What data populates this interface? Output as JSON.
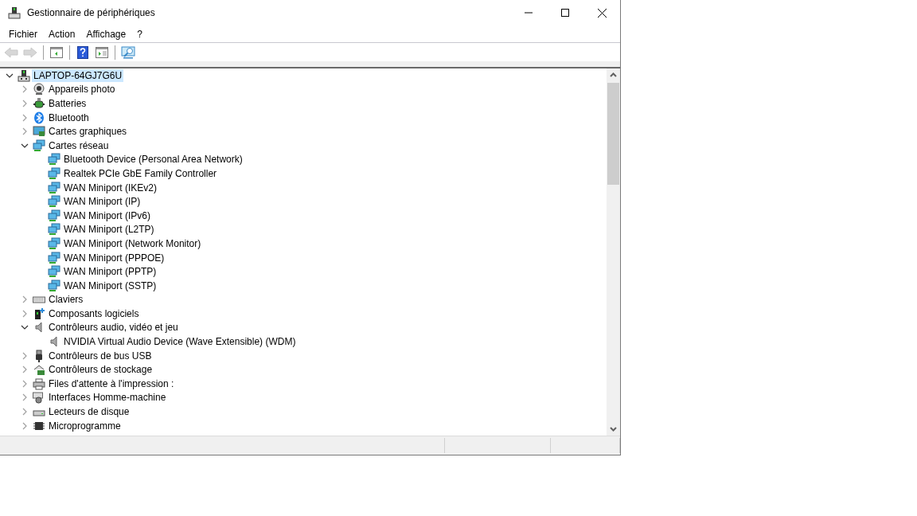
{
  "window": {
    "title": "Gestionnaire de périphériques"
  },
  "menu": [
    "Fichier",
    "Action",
    "Affichage",
    "?"
  ],
  "toolbar": [
    {
      "kind": "back",
      "disabled": true
    },
    {
      "kind": "forward",
      "disabled": true
    },
    {
      "kind": "separator"
    },
    {
      "kind": "pane",
      "disabled": false
    },
    {
      "kind": "separator"
    },
    {
      "kind": "help",
      "disabled": false
    },
    {
      "kind": "view",
      "disabled": false
    },
    {
      "kind": "separator"
    },
    {
      "kind": "scan",
      "disabled": false
    }
  ],
  "tree": {
    "label": "LAPTOP-64GJ7G6U",
    "kind": "computer",
    "expanded": true,
    "selected": true,
    "children": [
      {
        "label": "Appareils photo",
        "kind": "camera",
        "expanded": false,
        "selected": false
      },
      {
        "label": "Batteries",
        "kind": "battery",
        "expanded": false,
        "selected": false
      },
      {
        "label": "Bluetooth",
        "kind": "bluetooth",
        "expanded": false,
        "selected": false
      },
      {
        "label": "Cartes graphiques",
        "kind": "display",
        "expanded": false,
        "selected": false
      },
      {
        "label": "Cartes réseau",
        "kind": "network",
        "expanded": true,
        "selected": false,
        "children": [
          {
            "label": "Bluetooth Device (Personal Area Network)",
            "kind": "network",
            "selected": false
          },
          {
            "label": "Realtek PCIe GbE Family Controller",
            "kind": "network",
            "selected": false
          },
          {
            "label": "WAN Miniport (IKEv2)",
            "kind": "network",
            "selected": false
          },
          {
            "label": "WAN Miniport (IP)",
            "kind": "network",
            "selected": false
          },
          {
            "label": "WAN Miniport (IPv6)",
            "kind": "network",
            "selected": false
          },
          {
            "label": "WAN Miniport (L2TP)",
            "kind": "network",
            "selected": false
          },
          {
            "label": "WAN Miniport (Network Monitor)",
            "kind": "network",
            "selected": false
          },
          {
            "label": "WAN Miniport (PPPOE)",
            "kind": "network",
            "selected": false
          },
          {
            "label": "WAN Miniport (PPTP)",
            "kind": "network",
            "selected": false
          },
          {
            "label": "WAN Miniport (SSTP)",
            "kind": "network",
            "selected": false
          }
        ]
      },
      {
        "label": "Claviers",
        "kind": "keyboard",
        "expanded": false,
        "selected": false
      },
      {
        "label": "Composants logiciels",
        "kind": "software",
        "expanded": false,
        "selected": false
      },
      {
        "label": "Contrôleurs audio, vidéo et jeu",
        "kind": "audio",
        "expanded": true,
        "selected": false,
        "children": [
          {
            "label": "NVIDIA Virtual Audio Device (Wave Extensible) (WDM)",
            "kind": "audio",
            "selected": false
          }
        ]
      },
      {
        "label": "Contrôleurs de bus USB",
        "kind": "usb",
        "expanded": false,
        "selected": false
      },
      {
        "label": "Contrôleurs de stockage",
        "kind": "storage",
        "expanded": false,
        "selected": false
      },
      {
        "label": "Files d'attente à l'impression :",
        "kind": "printer",
        "expanded": false,
        "selected": false
      },
      {
        "label": "Interfaces Homme-machine",
        "kind": "hid",
        "expanded": false,
        "selected": false
      },
      {
        "label": "Lecteurs de disque",
        "kind": "disk",
        "expanded": false,
        "selected": false
      },
      {
        "label": "Microprogramme",
        "kind": "firmware",
        "expanded": false,
        "selected": false
      }
    ]
  }
}
